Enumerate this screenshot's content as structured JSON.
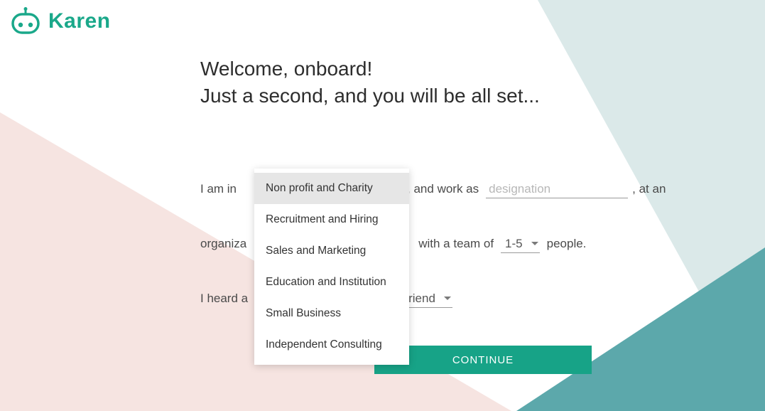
{
  "brand": {
    "name": "Karen"
  },
  "heading": {
    "line1": "Welcome, onboard!",
    "line2": "Just a second, and you will be all set..."
  },
  "form": {
    "line1_prefix": "I am in",
    "line1_middle": ", and work as",
    "designation_placeholder": "designation",
    "line1_suffix": ", at an",
    "line2_prefix": "organiza",
    "line2_middle": "with a team of",
    "team_value": "1-5",
    "line2_suffix": "people.",
    "line3_prefix": "I heard a",
    "source_value": "riend"
  },
  "industry_dropdown": {
    "options": [
      "Non profit and Charity",
      "Recruitment and Hiring",
      "Sales and Marketing",
      "Education and Institution",
      "Small Business",
      "Independent Consulting"
    ],
    "highlighted": "Non profit and Charity"
  },
  "continue_label": "CONTINUE",
  "colors": {
    "brand": "#1aa88a",
    "accent_button": "#17a387",
    "bg_pink": "#f6e4e1",
    "bg_teal_light": "#dbe9e9",
    "bg_teal_dark": "#5ca8ab"
  }
}
